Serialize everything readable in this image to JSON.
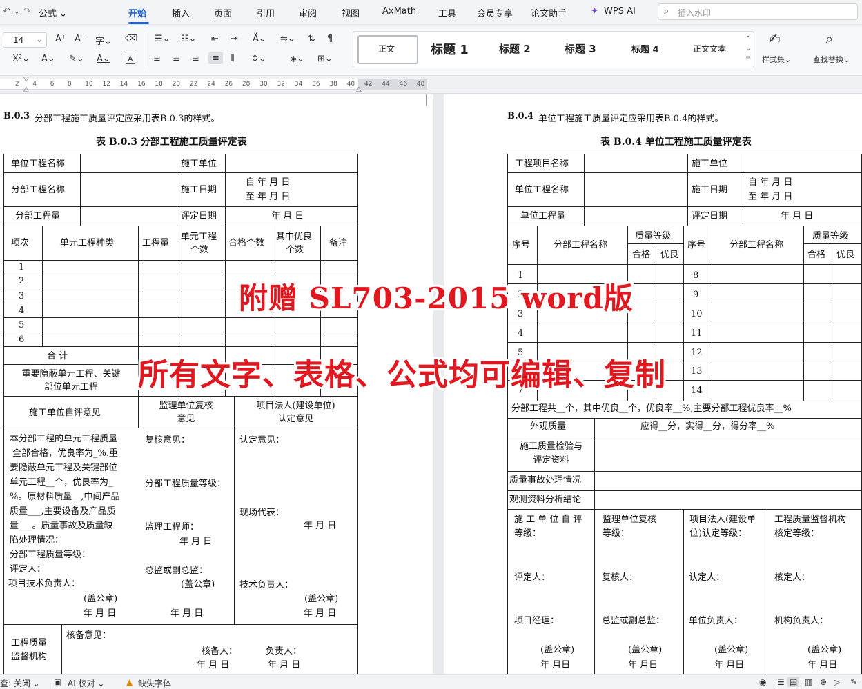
{
  "tabbar": {
    "formula": "公式",
    "tabs": [
      "开始",
      "插入",
      "页面",
      "引用",
      "审阅",
      "视图",
      "AxMath",
      "工具",
      "会员专享",
      "论文助手",
      "WPS AI"
    ],
    "search_placeholder": "插入水印"
  },
  "ribbon": {
    "font_size": "14",
    "styles": [
      "正文",
      "标题 1",
      "标题 2",
      "标题 3",
      "标题 4",
      "正文文本"
    ],
    "style_set_label": "样式集",
    "find_replace_label": "查找替换"
  },
  "ruler": {
    "ticks": [
      "2",
      "4",
      "6",
      "8",
      "10",
      "12",
      "14",
      "16",
      "18",
      "20",
      "22",
      "24",
      "26",
      "28",
      "30",
      "32",
      "34",
      "36",
      "38",
      "40",
      "42",
      "44",
      "46",
      "48"
    ]
  },
  "left_page": {
    "clause": "B.0.3",
    "clause_text": "分部工程施工质量评定应采用表B.0.3的样式。",
    "table_title": "表 B.0.3  分部工程施工质量评定表",
    "row_unit_name": "单位工程名称",
    "row_constr_unit": "施工单位",
    "row_sub_name": "分部工程名称",
    "row_constr_date": "施工日期",
    "date_from": "自  年  月  日",
    "date_to": "至  年  月  日",
    "row_sub_qty": "分部工程量",
    "row_eval_date": "评定日期",
    "eval_date_value": "年  月  日",
    "headers": [
      "项次",
      "单元工程种类",
      "工程量",
      "单元工程\n个数",
      "合格个数",
      "其中优良\n个数",
      "备注"
    ],
    "row_numbers": [
      "1",
      "2",
      "3",
      "4",
      "5",
      "6"
    ],
    "total": "合    计",
    "key_units": "重要隐蔽单元工程、关键\n部位单元工程",
    "opinion_constr": "施工单位自评意见",
    "opinion_supervisor": "监理单位复核\n意见",
    "opinion_owner": "项目法人(建设单位)\n认定意见",
    "constr_text": [
      "本分部工程的单元工程质量",
      "全部合格，优良率为_%.重",
      "要隐蔽单元工程及关键部位",
      "单元工程__个，优良率为_",
      "%。原材料质量__,中间产品",
      "质量___,主要设备及产品质",
      "量___。质量事故及质量缺",
      "陷处理情况：",
      "分部工程质量等级：",
      "评定人：",
      "项目技术负责人："
    ],
    "constr_seal": "(盖公章)",
    "constr_date": "年  月  日",
    "sup_review": "复核意见：",
    "sup_grade": "分部工程质量等级：",
    "sup_engineer": "监理工程师：",
    "sup_date1": "年 月  日",
    "sup_chief": "总监或副总监：",
    "sup_seal": "(盖公章)",
    "sup_date2": "年 月   日",
    "own_opinion": "认定意见：",
    "own_rep": "现场代表：",
    "own_date1": "年 月 日",
    "own_tech": "技术负责人：",
    "own_seal": "(盖公章)",
    "own_date2": "年  月   日",
    "qs_label": "工程质量\n监督机构",
    "qs_opinion": "核备意见：",
    "qs_checker": "核备人：",
    "qs_head": "负责人：",
    "qs_date1": "年  月   日",
    "qs_date2": "年 月  日"
  },
  "right_page": {
    "clause": "B.0.4",
    "clause_text": "单位工程施工质量评定应采用表B.0.4的样式。",
    "table_title": "表 B.0.4  单位工程施工质量评定表",
    "row_proj_name": "工程项目名称",
    "row_constr_unit": "施工单位",
    "row_unit_name": "单位工程名称",
    "row_constr_date": "施工日期",
    "date_from": "自    年    月    日",
    "date_to": "至    年    月    日",
    "row_unit_qty": "单位工程量",
    "row_eval_date": "评定日期",
    "eval_date_value": "年   月    日",
    "seq": "序号",
    "sub_name": "分部工程名称",
    "quality_grade": "质量等级",
    "pass": "合格",
    "good": "优良",
    "seq_left": [
      "1",
      "2",
      "3",
      "4",
      "5",
      "6",
      "7"
    ],
    "seq_right": [
      "8",
      "9",
      "10",
      "11",
      "12",
      "13",
      "14"
    ],
    "summary": "分部工程共__个，其中优良__个，优良率__%,主要分部工程优良率__%",
    "appearance": "外观质量",
    "appearance_value": "应得__分，实得__分，得分率__%",
    "inspection": "施工质量检验与\n评定资料",
    "accident": "质量事故处理情况",
    "observation": "观测资料分析结论",
    "col1_title": "施 工 单 位 自 评\n等级：",
    "col2_title": "监理单位复核\n等级：",
    "col3_title": "项目法人(建设单\n位)认定等级：",
    "col4_title": "工程质量监督机构\n核定等级：",
    "evaluator": "评定人：",
    "reviewer": "复核人：",
    "confirmer": "认定人：",
    "verifier": "核定人：",
    "pm": "项目经理：",
    "chief": "总监或副总监：",
    "unit_head": "单位负责人：",
    "agency_head": "机构负责人：",
    "seal": "(盖公章)",
    "date": "年  月日"
  },
  "overlays": {
    "line1": "附赠  SL703-2015 word版",
    "line2": "所有文字、表格、公式均可编辑、复制"
  },
  "statusbar": {
    "revise": "査: 关闭",
    "ai_check": "AI 校对",
    "missing_font": "缺失字体"
  }
}
